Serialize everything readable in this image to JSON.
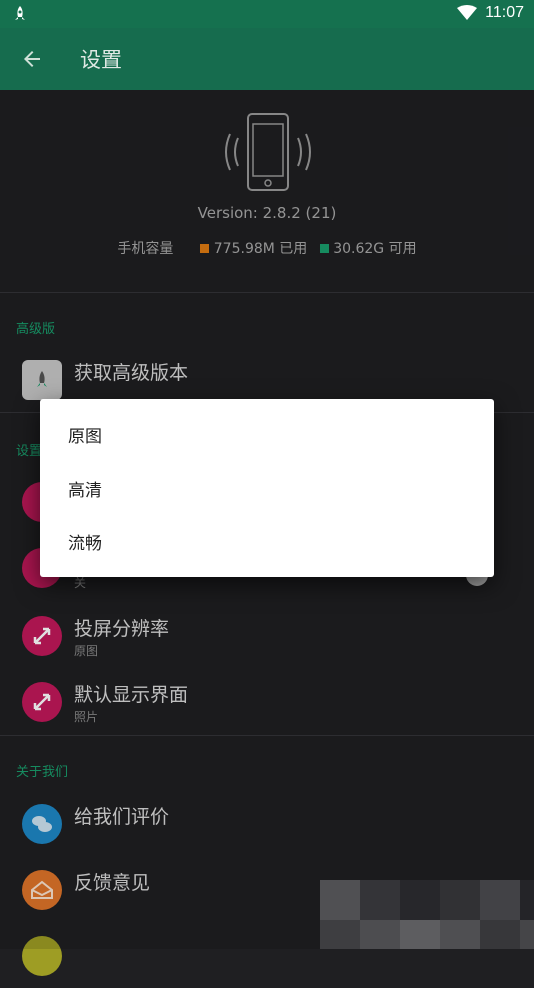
{
  "statusbar": {
    "time": "11:07"
  },
  "appbar": {
    "title": "设置"
  },
  "device": {
    "version": "Version: 2.8.2 (21)",
    "storage_label": "手机容量",
    "used": "775.98M 已用",
    "free": "30.62G 可用",
    "used_color": "#e07b12",
    "free_color": "#1a9f6d"
  },
  "sections": {
    "premium": "高级版",
    "settings": "设置",
    "about": "关于我们"
  },
  "items": {
    "get_premium": {
      "label": "获取高级版本"
    },
    "hidden_sub": "关",
    "resolution": {
      "label": "投屏分辨率",
      "sub": "原图"
    },
    "default_view": {
      "label": "默认显示界面",
      "sub": "照片"
    },
    "rate": {
      "label": "给我们评价"
    },
    "feedback": {
      "label": "反馈意见"
    }
  },
  "dialog": {
    "options": [
      "原图",
      "高清",
      "流畅"
    ]
  }
}
